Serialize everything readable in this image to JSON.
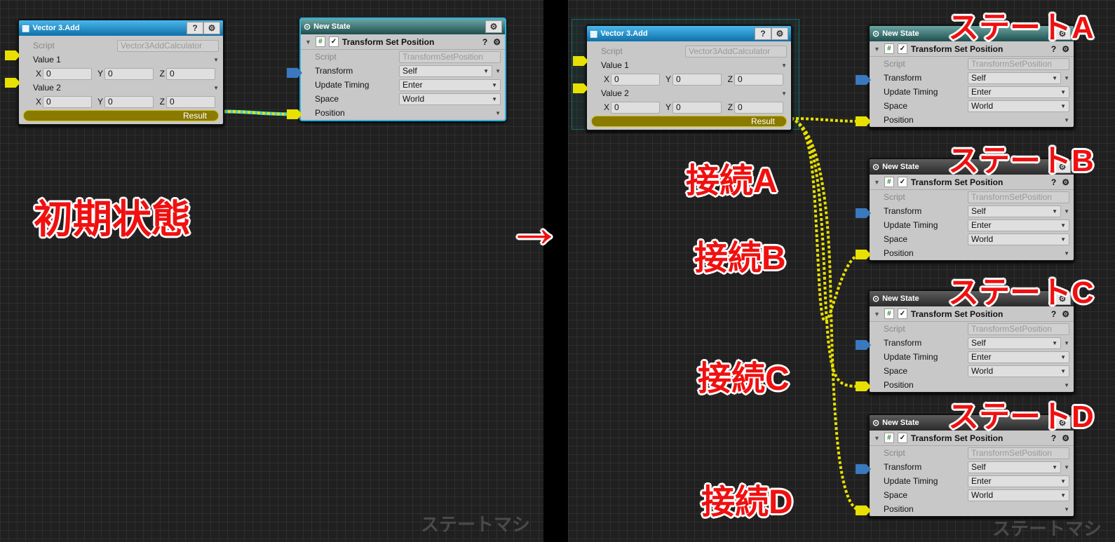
{
  "left": {
    "watermark": "ステートマシ",
    "vector_node": {
      "title": "Vector 3.Add",
      "script_label": "Script",
      "script_value": "Vector3AddCalculator",
      "value1": "Value 1",
      "value2": "Value 2",
      "x": "0",
      "y": "0",
      "z": "0",
      "result": "Result",
      "selected": false
    },
    "state_node": {
      "title": "New State",
      "component": "Transform Set Position",
      "script_label": "Script",
      "script_value": "TransformSetPosition",
      "transform_label": "Transform",
      "transform_value": "Self",
      "timing_label": "Update Timing",
      "timing_value": "Enter",
      "space_label": "Space",
      "space_value": "World",
      "position_label": "Position",
      "header": "teal",
      "selected": true
    }
  },
  "right": {
    "watermark": "ステートマシ",
    "vector_node": {
      "title": "Vector 3.Add",
      "script_label": "Script",
      "script_value": "Vector3AddCalculator",
      "value1": "Value 1",
      "value2": "Value 2",
      "x": "0",
      "y": "0",
      "z": "0",
      "result": "Result",
      "selected": true
    },
    "states": [
      {
        "title": "New State",
        "component": "Transform Set Position",
        "script_label": "Script",
        "script_value": "TransformSetPosition",
        "transform_label": "Transform",
        "transform_value": "Self",
        "timing_label": "Update Timing",
        "timing_value": "Enter",
        "space_label": "Space",
        "space_value": "World",
        "position_label": "Position",
        "header": "teal"
      },
      {
        "title": "New State",
        "component": "Transform Set Position",
        "script_label": "Script",
        "script_value": "TransformSetPosition",
        "transform_label": "Transform",
        "transform_value": "Self",
        "timing_label": "Update Timing",
        "timing_value": "Enter",
        "space_label": "Space",
        "space_value": "World",
        "position_label": "Position",
        "header": "gray"
      },
      {
        "title": "New State",
        "component": "Transform Set Position",
        "script_label": "Script",
        "script_value": "TransformSetPosition",
        "transform_label": "Transform",
        "transform_value": "Self",
        "timing_label": "Update Timing",
        "timing_value": "Enter",
        "space_label": "Space",
        "space_value": "World",
        "position_label": "Position",
        "header": "gray"
      },
      {
        "title": "New State",
        "component": "Transform Set Position",
        "script_label": "Script",
        "script_value": "TransformSetPosition",
        "transform_label": "Transform",
        "transform_value": "Self",
        "timing_label": "Update Timing",
        "timing_value": "Enter",
        "space_label": "Space",
        "space_value": "World",
        "position_label": "Position",
        "header": "gray"
      }
    ]
  },
  "annotations": {
    "initial": "初期状態",
    "arrow": "→",
    "states": [
      "ステートA",
      "ステートB",
      "ステートC",
      "ステートD"
    ],
    "connections": [
      "接続A",
      "接続B",
      "接続C",
      "接続D"
    ]
  },
  "colors": {
    "connection": "#e8e000",
    "annotation": "#f01010",
    "selection": "#2cb0e0"
  }
}
